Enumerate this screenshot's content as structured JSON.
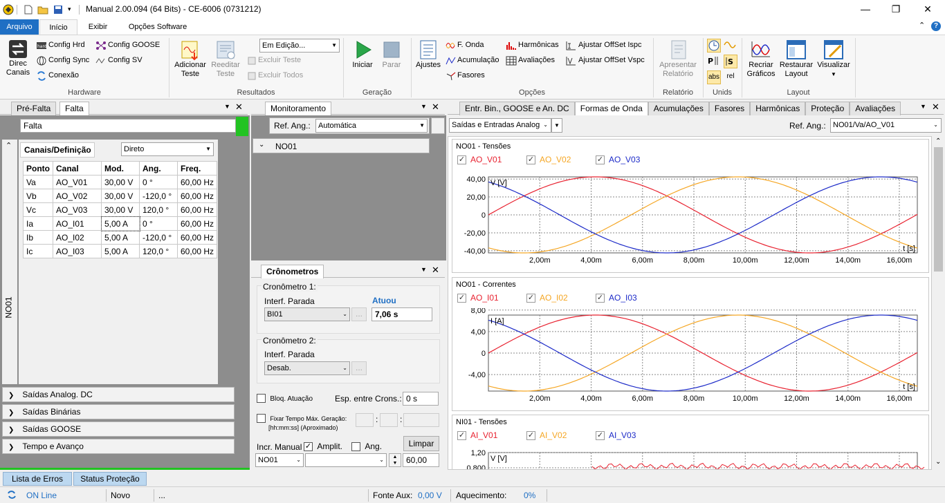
{
  "window": {
    "title": "Manual 2.00.094 (64 Bits) - CE-6006 (0731212)",
    "minimize_glyph": "—",
    "restore_glyph": "❐",
    "close_glyph": "✕"
  },
  "menu": {
    "tabs": [
      "Arquivo",
      "Início",
      "Exibir",
      "Opções Software"
    ],
    "help_glyph": "?"
  },
  "ribbon": {
    "hardware": {
      "group_label": "Hardware",
      "direc_canais_1": "Direc",
      "direc_canais_2": "Canais",
      "config_hrd": "Config Hrd",
      "config_sync": "Config Sync",
      "conexao": "Conexão",
      "config_goose": "Config GOOSE",
      "config_sv": "Config SV"
    },
    "resultados": {
      "group_label": "Resultados",
      "adicionar_1": "Adicionar",
      "adicionar_2": "Teste",
      "reeditar_1": "Reeditar",
      "reeditar_2": "Teste",
      "mode_value": "Em Edição...",
      "excluir_teste": "Excluir Teste",
      "excluir_todos": "Excluir Todos"
    },
    "geracao": {
      "group_label": "Geração",
      "iniciar": "Iniciar",
      "parar": "Parar"
    },
    "opcoes": {
      "group_label": "Opções",
      "ajustes": "Ajustes",
      "f_onda": "F. Onda",
      "acumulacao": "Acumulação",
      "fasores": "Fasores",
      "harmonicas": "Harmônicas",
      "avaliacoes": "Avaliações",
      "ajustar_ispc": "Ajustar OffSet Ispc",
      "ajustar_vspc": "Ajustar OffSet Vspc"
    },
    "relatorio": {
      "group_label": "Relatório",
      "apresentar_1": "Apresentar",
      "apresentar_2": "Relatório"
    },
    "unids": {
      "group_label": "Unids",
      "abs": "abs",
      "rel": "rel"
    },
    "layout": {
      "group_label": "Layout",
      "recriar_1": "Recriar",
      "recriar_2": "Gráficos",
      "restaurar_1": "Restaurar",
      "restaurar_2": "Layout",
      "visualizar": "Visualizar"
    }
  },
  "left_panel": {
    "tabs": [
      "Pré-Falta",
      "Falta"
    ],
    "state_name": "Falta",
    "side_label": "NO01",
    "subtab": "Canais/Definição",
    "mode_select": "Direto",
    "columns": [
      "Ponto",
      "Canal",
      "Mod.",
      "Ang.",
      "Freq."
    ],
    "rows": [
      [
        "Va",
        "AO_V01",
        "30,00 V",
        "0 °",
        "60,00 Hz"
      ],
      [
        "Vb",
        "AO_V02",
        "30,00 V",
        "-120,0 °",
        "60,00 Hz"
      ],
      [
        "Vc",
        "AO_V03",
        "30,00 V",
        "120,0 °",
        "60,00 Hz"
      ],
      [
        "Ia",
        "AO_I01",
        "5,00 A",
        "0 °",
        "60,00 Hz"
      ],
      [
        "Ib",
        "AO_I02",
        "5,00 A",
        "-120,0 °",
        "60,00 Hz"
      ],
      [
        "Ic",
        "AO_I03",
        "5,00 A",
        "120,0 °",
        "60,00 Hz"
      ]
    ],
    "accordions": [
      "Saídas Analog. DC",
      "Saídas Binárias",
      "Saídas GOOSE",
      "Tempo e Avanço"
    ]
  },
  "monitor_panel": {
    "tab": "Monitoramento",
    "ref_label": "Ref. Ang.:",
    "ref_value": "Automática",
    "node": "NO01"
  },
  "crono_panel": {
    "tab": "Crônometros",
    "c1_title": "Cronômetro 1:",
    "c1_interf_label": "Interf. Parada",
    "c1_interf_value": "BI01",
    "c1_status": "Atuou",
    "c1_time": "7,06 s",
    "c2_title": "Cronômetro 2:",
    "c2_interf_label": "Interf. Parada",
    "c2_interf_value": "Desab.",
    "ellipsis": "...",
    "bloq_label": "Bloq. Atuação",
    "esp_label": "Esp. entre Crons.:",
    "esp_value": "0 s",
    "fixar_label": "Fixar Tempo Máx. Geração:",
    "fixar_hint": "[hh:mm:ss] (Aproximado)",
    "colon": ":",
    "limpar": "Limpar",
    "incr_label": "Incr. Manual",
    "amplit_label": "Amplit.",
    "ang_label": "Ang.",
    "incr_node": "NO01",
    "incr_value": "60,00"
  },
  "right_panel": {
    "tabs": [
      "Entr. Bin., GOOSE e An. DC",
      "Formas de Onda",
      "Acumulações",
      "Fasores",
      "Harmônicas",
      "Proteção",
      "Avaliações"
    ],
    "view_select": "Saídas e Entradas Analog",
    "ref_label": "Ref. Ang.:",
    "ref_value": "NO01/Va/AO_V01"
  },
  "chart_data": [
    {
      "type": "line",
      "title": "NO01 - Tensões",
      "ylabel": "V [V]",
      "xlabel": "t [s]",
      "x_ticks": [
        "2,00m",
        "4,00m",
        "6,00m",
        "8,00m",
        "10,00m",
        "12,00m",
        "14,00m",
        "16,00m"
      ],
      "y_ticks": [
        "40,00",
        "20,00",
        "0",
        "-20,00",
        "-40,00"
      ],
      "xlim": [
        0,
        0.0167
      ],
      "ylim": [
        -42.4,
        42.4
      ],
      "grid": true,
      "series": [
        {
          "name": "AO_V01",
          "color": "#e8212f",
          "amplitude": 42.43,
          "phase_deg": 0,
          "frequency_hz": 60
        },
        {
          "name": "AO_V02",
          "color": "#f5a623",
          "amplitude": 42.43,
          "phase_deg": -120,
          "frequency_hz": 60
        },
        {
          "name": "AO_V03",
          "color": "#1c2ac8",
          "amplitude": 42.43,
          "phase_deg": 120,
          "frequency_hz": 60
        }
      ]
    },
    {
      "type": "line",
      "title": "NO01 - Correntes",
      "ylabel": "I [A]",
      "xlabel": "t [s]",
      "x_ticks": [
        "2,00m",
        "4,00m",
        "6,00m",
        "8,00m",
        "10,00m",
        "12,00m",
        "14,00m",
        "16,00m"
      ],
      "y_ticks": [
        "8,00",
        "4,00",
        "0",
        "-4,00"
      ],
      "xlim": [
        0,
        0.0167
      ],
      "ylim": [
        -7.07,
        7.07
      ],
      "grid": true,
      "series": [
        {
          "name": "AO_I01",
          "color": "#e8212f",
          "amplitude": 7.07,
          "phase_deg": 0,
          "frequency_hz": 60
        },
        {
          "name": "AO_I02",
          "color": "#f5a623",
          "amplitude": 7.07,
          "phase_deg": -120,
          "frequency_hz": 60
        },
        {
          "name": "AO_I03",
          "color": "#1c2ac8",
          "amplitude": 7.07,
          "phase_deg": 120,
          "frequency_hz": 60
        }
      ]
    },
    {
      "type": "line",
      "title": "NI01 - Tensões",
      "ylabel": "V [V]",
      "y_ticks": [
        "1,20",
        "0,800"
      ],
      "grid": true,
      "series": [
        {
          "name": "AI_V01",
          "color": "#e8212f"
        },
        {
          "name": "AI_V02",
          "color": "#f5a623"
        },
        {
          "name": "AI_V03",
          "color": "#1c2ac8"
        }
      ]
    }
  ],
  "bottom": {
    "tabs": [
      "Lista de Erros",
      "Status Proteção"
    ],
    "online": "ON Line",
    "state": "Novo",
    "dots": "...",
    "fonte_label": "Fonte Aux:",
    "fonte_value": "0,00 V",
    "aquec_label": "Aquecimento:",
    "aquec_value": "0%"
  },
  "colors": {
    "accent": "#1f6fc4",
    "green_status": "#22c322",
    "series_red": "#e8212f",
    "series_orange": "#f5a623",
    "series_blue": "#1c2ac8"
  }
}
